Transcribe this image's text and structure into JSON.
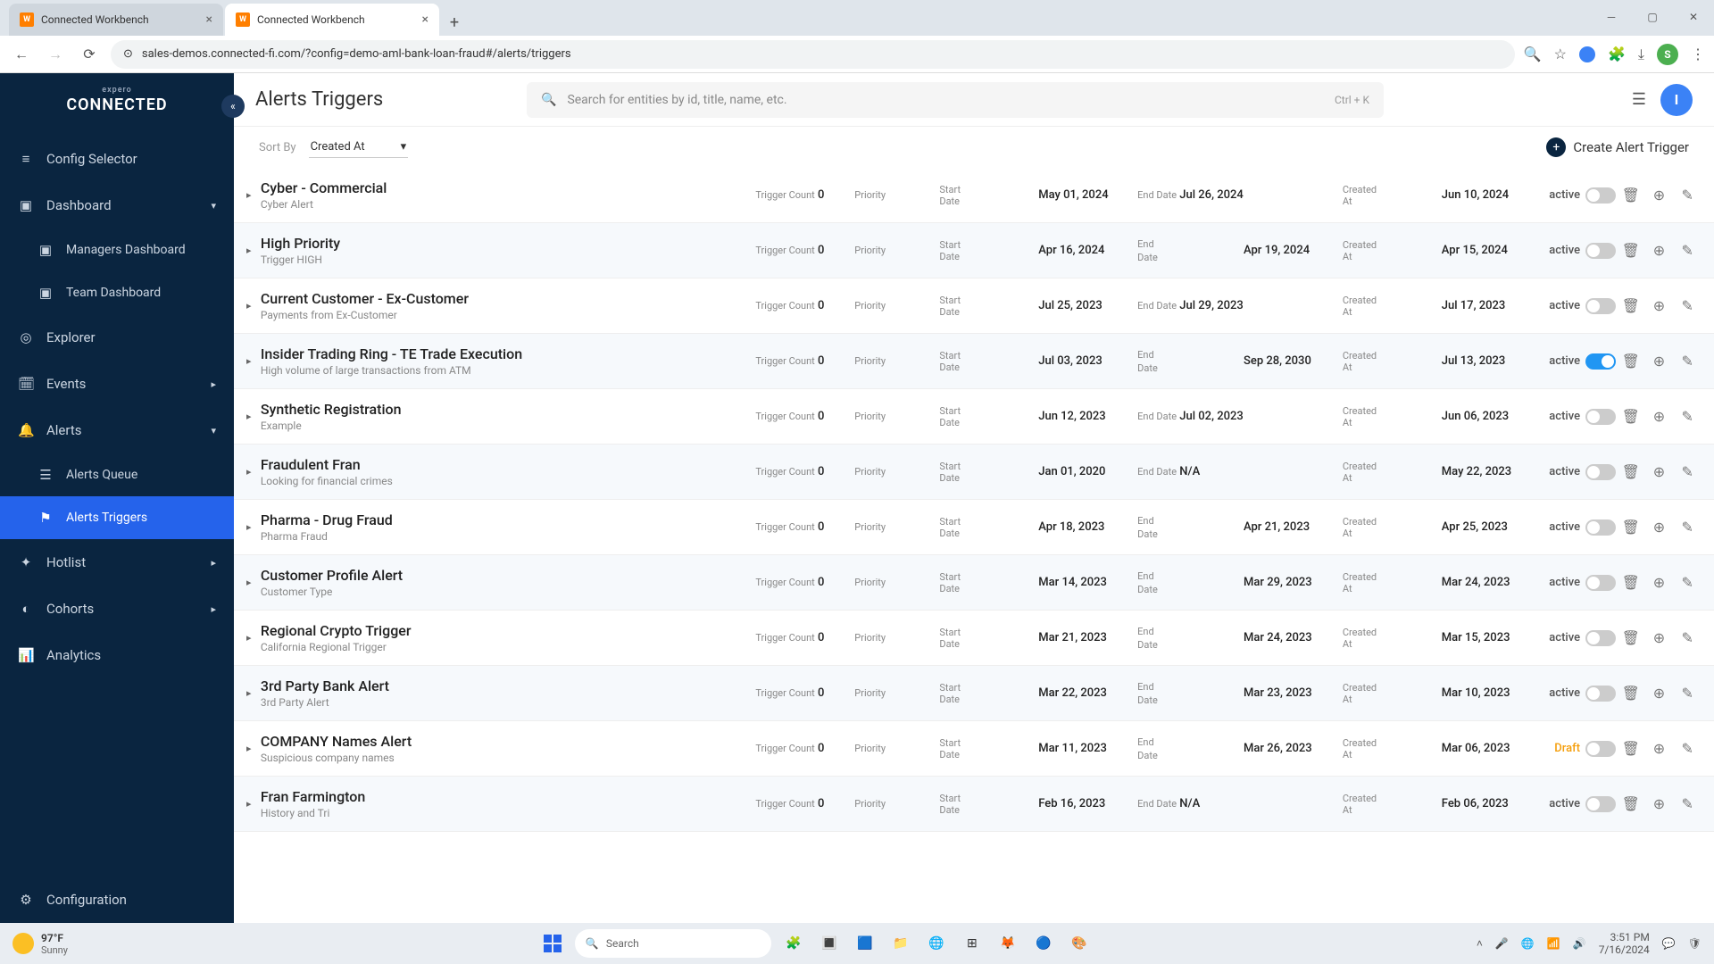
{
  "browser": {
    "tabs": [
      {
        "title": "Connected Workbench",
        "active": false
      },
      {
        "title": "Connected Workbench",
        "active": true
      }
    ],
    "url": "sales-demos.connected-fi.com/?config=demo-aml-bank-loan-fraud#/alerts/triggers",
    "avatar": "S"
  },
  "sidebar": {
    "logo_small": "expero",
    "logo": "CONNECTED",
    "items": [
      {
        "label": "Config Selector",
        "icon": "≡"
      },
      {
        "label": "Dashboard",
        "icon": "▣",
        "expand": "▾"
      },
      {
        "label": "Managers Dashboard",
        "icon": "▣",
        "sub": true
      },
      {
        "label": "Team Dashboard",
        "icon": "▣",
        "sub": true
      },
      {
        "label": "Explorer",
        "icon": "◎"
      },
      {
        "label": "Events",
        "icon": "🗓",
        "expand": "▸"
      },
      {
        "label": "Alerts",
        "icon": "🔔",
        "expand": "▾"
      },
      {
        "label": "Alerts Queue",
        "icon": "☰",
        "sub": true
      },
      {
        "label": "Alerts Triggers",
        "icon": "⚑",
        "sub": true,
        "selected": true
      },
      {
        "label": "Hotlist",
        "icon": "✦",
        "expand": "▸"
      },
      {
        "label": "Cohorts",
        "icon": "◐",
        "expand": "▸"
      },
      {
        "label": "Analytics",
        "icon": "📊"
      }
    ],
    "footer": {
      "label": "Configuration",
      "icon": "⚙"
    }
  },
  "header": {
    "title": "Alerts Triggers",
    "search_placeholder": "Search for entities by id, title, name, etc.",
    "kbd": "Ctrl + K",
    "avatar": "I"
  },
  "toolbar": {
    "sort_label": "Sort By",
    "sort_value": "Created At",
    "create_label": "Create Alert Trigger"
  },
  "labels": {
    "trigger_count": "Trigger Count",
    "priority": "Priority",
    "start_date": "Start Date",
    "end_date": "End Date",
    "created_at": "Created At",
    "active": "active",
    "draft": "Draft"
  },
  "rows": [
    {
      "title": "Cyber - Commercial",
      "sub": "Cyber Alert",
      "count": "0",
      "start": "May 01, 2024",
      "end": "Jul 26, 2024",
      "end_inline": true,
      "created": "Jun 10, 2024",
      "status": "active",
      "on": false
    },
    {
      "title": "High Priority",
      "sub": "Trigger HIGH",
      "count": "0",
      "start": "Apr 16, 2024",
      "end": "Apr 19, 2024",
      "created": "Apr 15, 2024",
      "status": "active",
      "on": false
    },
    {
      "title": "Current Customer - Ex-Customer",
      "sub": "Payments from Ex-Customer",
      "count": "0",
      "start": "Jul 25, 2023",
      "end": "Jul 29, 2023",
      "end_inline": true,
      "created": "Jul 17, 2023",
      "status": "active",
      "on": false
    },
    {
      "title": "Insider Trading Ring - TE Trade Execution",
      "sub": "High volume of large transactions from ATM",
      "count": "0",
      "start": "Jul 03, 2023",
      "end": "Sep 28, 2030",
      "created": "Jul 13, 2023",
      "status": "active",
      "on": true
    },
    {
      "title": "Synthetic Registration",
      "sub": "Example",
      "count": "0",
      "start": "Jun 12, 2023",
      "end": "Jul 02, 2023",
      "end_inline": true,
      "created": "Jun 06, 2023",
      "status": "active",
      "on": false
    },
    {
      "title": "Fraudulent Fran",
      "sub": "Looking for financial crimes",
      "count": "0",
      "start": "Jan 01, 2020",
      "end": "N/A",
      "end_inline": true,
      "created": "May 22, 2023",
      "status": "active",
      "on": false
    },
    {
      "title": "Pharma - Drug Fraud",
      "sub": "Pharma Fraud",
      "count": "0",
      "start": "Apr 18, 2023",
      "end": "Apr 21, 2023",
      "created": "Apr 25, 2023",
      "status": "active",
      "on": false
    },
    {
      "title": "Customer Profile Alert",
      "sub": "Customer Type",
      "count": "0",
      "start": "Mar 14, 2023",
      "end": "Mar 29, 2023",
      "created": "Mar 24, 2023",
      "status": "active",
      "on": false
    },
    {
      "title": "Regional Crypto Trigger",
      "sub": "California Regional Trigger",
      "count": "0",
      "start": "Mar 21, 2023",
      "end": "Mar 24, 2023",
      "created": "Mar 15, 2023",
      "status": "active",
      "on": false
    },
    {
      "title": "3rd Party Bank Alert",
      "sub": "3rd Party Alert",
      "count": "0",
      "start": "Mar 22, 2023",
      "end": "Mar 23, 2023",
      "created": "Mar 10, 2023",
      "status": "active",
      "on": false
    },
    {
      "title": "COMPANY Names Alert",
      "sub": "Suspicious company names",
      "count": "0",
      "start": "Mar 11, 2023",
      "end": "Mar 26, 2023",
      "created": "Mar 06, 2023",
      "status": "Draft",
      "on": false,
      "draft": true
    },
    {
      "title": "Fran Farmington",
      "sub": "History and Tri",
      "count": "0",
      "start": "Feb 16, 2023",
      "end": "N/A",
      "end_inline": true,
      "created": "Feb 06, 2023",
      "status": "active",
      "on": false
    }
  ],
  "taskbar": {
    "temp": "97°F",
    "weather": "Sunny",
    "search": "Search",
    "time": "3:51 PM",
    "date": "7/16/2024"
  }
}
